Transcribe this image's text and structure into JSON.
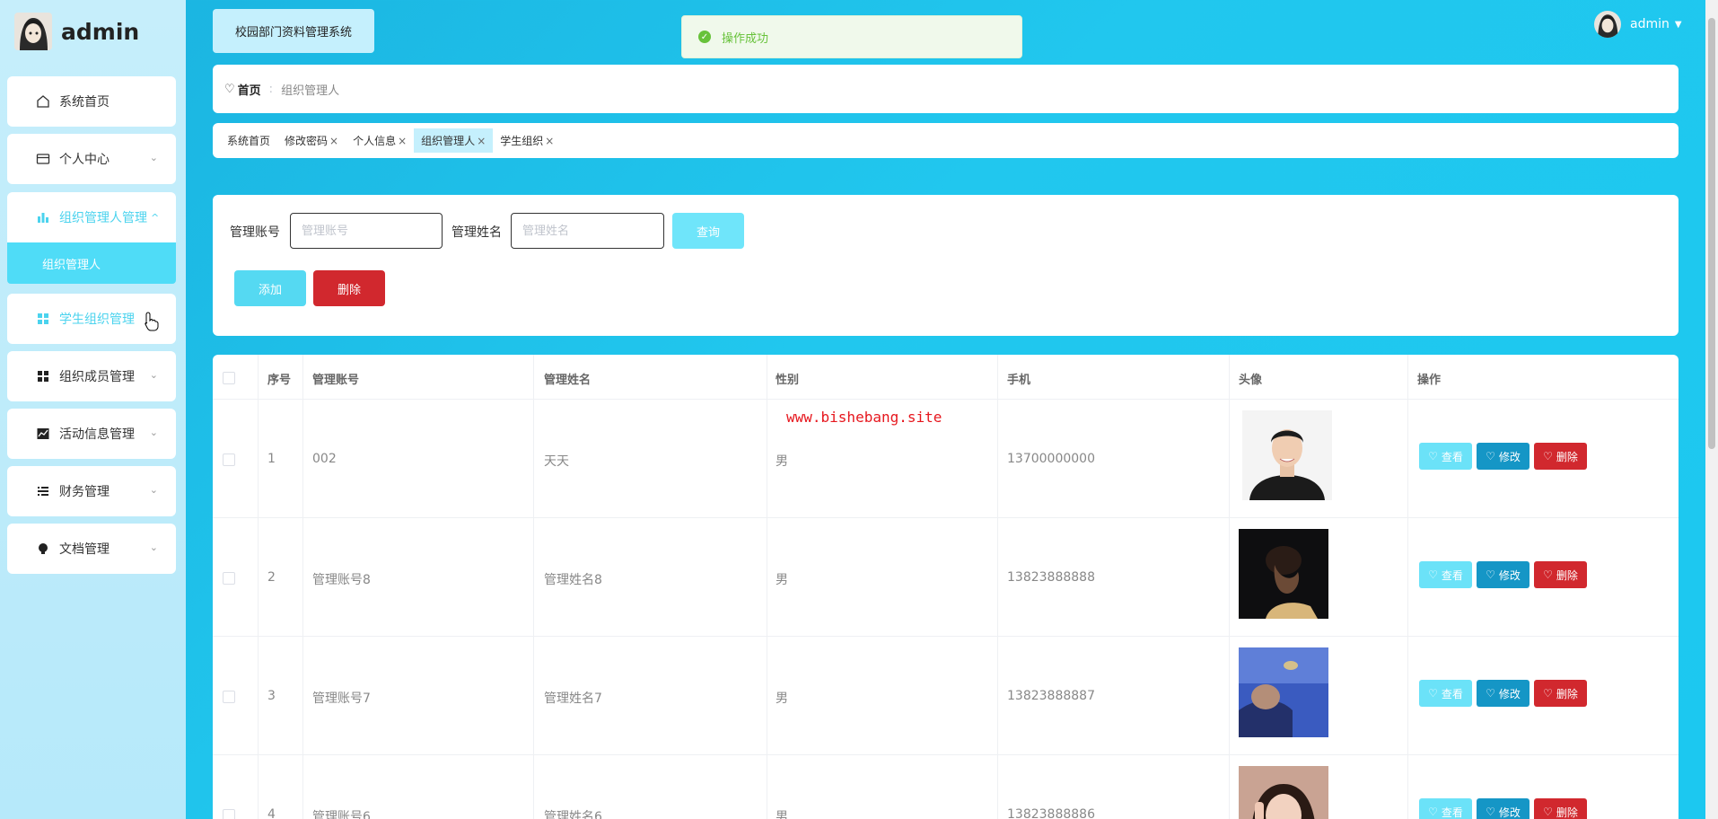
{
  "sidebar": {
    "username": "admin",
    "items": [
      {
        "label": "系统首页",
        "icon": "home-icon"
      },
      {
        "label": "个人中心",
        "icon": "card-icon"
      },
      {
        "label": "组织管理人管理",
        "icon": "bar-chart-icon"
      },
      {
        "label": "学生组织管理",
        "icon": "grid-icon"
      },
      {
        "label": "组织成员管理",
        "icon": "grid-icon"
      },
      {
        "label": "活动信息管理",
        "icon": "line-chart-icon"
      },
      {
        "label": "财务管理",
        "icon": "list-icon"
      },
      {
        "label": "文档管理",
        "icon": "bulb-icon"
      }
    ],
    "submenu_label": "组织管理人"
  },
  "header": {
    "system_title": "校园部门资料管理系统",
    "toast": "操作成功",
    "user": "admin"
  },
  "breadcrumb": {
    "home": "首页",
    "current": "组织管理人"
  },
  "tabs": [
    {
      "label": "系统首页",
      "closable": false
    },
    {
      "label": "修改密码",
      "closable": true
    },
    {
      "label": "个人信息",
      "closable": true
    },
    {
      "label": "组织管理人",
      "closable": true,
      "active": true
    },
    {
      "label": "学生组织",
      "closable": true
    }
  ],
  "search": {
    "account_label": "管理账号",
    "account_placeholder": "管理账号",
    "name_label": "管理姓名",
    "name_placeholder": "管理姓名",
    "query_label": "查询",
    "add_label": "添加",
    "delete_label": "删除"
  },
  "table": {
    "headers": [
      "序号",
      "管理账号",
      "管理姓名",
      "性别",
      "手机",
      "头像",
      "操作"
    ],
    "rows": [
      {
        "index": "1",
        "account": "002",
        "name": "天天",
        "gender": "男",
        "phone": "13700000000"
      },
      {
        "index": "2",
        "account": "管理账号8",
        "name": "管理姓名8",
        "gender": "男",
        "phone": "13823888888"
      },
      {
        "index": "3",
        "account": "管理账号7",
        "name": "管理姓名7",
        "gender": "男",
        "phone": "13823888887"
      },
      {
        "index": "4",
        "account": "管理账号6",
        "name": "管理姓名6",
        "gender": "男",
        "phone": "13823888886"
      }
    ],
    "actions": {
      "view": "查看",
      "edit": "修改",
      "delete": "删除"
    }
  },
  "watermark": "www.bishebang.site",
  "colors": {
    "accent": "#4bd3ee",
    "danger": "#d1282e",
    "edit": "#1596c6",
    "success": "#67c23a"
  }
}
